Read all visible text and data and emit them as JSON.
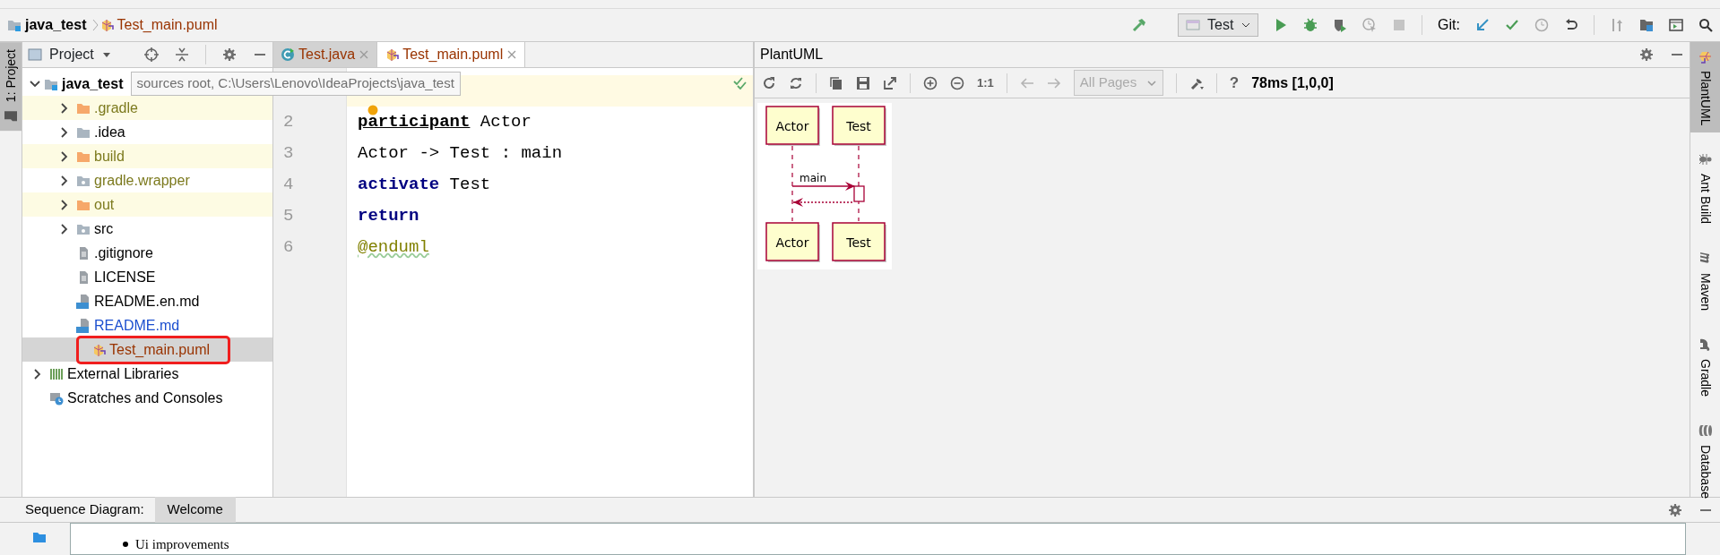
{
  "breadcrumbs": [
    {
      "label": "java_test",
      "kind": "project"
    },
    {
      "label": "Test_main.puml",
      "kind": "puml"
    }
  ],
  "run_config": {
    "label": "Test"
  },
  "git_label": "Git:",
  "left_tool_tabs": [
    {
      "label": "1: Project",
      "selected": true
    }
  ],
  "project_panel": {
    "title": "Project",
    "tree": [
      {
        "label": "java_test",
        "kind": "module",
        "expanded": true,
        "color": "#000000",
        "tooltip": "sources root,  C:\\Users\\Lenovo\\IdeaProjects\\java_test",
        "children": [
          {
            "label": ".gradle",
            "kind": "folder-excluded",
            "expanded": false,
            "color": "#7c7a1e"
          },
          {
            "label": ".idea",
            "kind": "folder",
            "expanded": false,
            "color": "#000000"
          },
          {
            "label": "build",
            "kind": "folder-excluded",
            "expanded": false,
            "color": "#7c7a1e"
          },
          {
            "label": "gradle.wrapper",
            "kind": "folder-package",
            "expanded": false,
            "color": "#7c7a1e"
          },
          {
            "label": "out",
            "kind": "folder-excluded",
            "expanded": false,
            "color": "#7c7a1e"
          },
          {
            "label": "src",
            "kind": "folder-package",
            "expanded": false,
            "color": "#000000"
          },
          {
            "label": ".gitignore",
            "kind": "file",
            "color": "#000000"
          },
          {
            "label": "LICENSE",
            "kind": "file",
            "color": "#000000"
          },
          {
            "label": "README.en.md",
            "kind": "markdown",
            "color": "#000000"
          },
          {
            "label": "README.md",
            "kind": "markdown",
            "color": "#1c4fcf"
          },
          {
            "label": "Test_main.puml",
            "kind": "puml",
            "color": "#993300",
            "selected": true,
            "marked": true
          }
        ]
      },
      {
        "label": "External Libraries",
        "kind": "libraries",
        "expanded": false,
        "color": "#000000"
      },
      {
        "label": "Scratches and Consoles",
        "kind": "scratches",
        "color": "#000000"
      }
    ]
  },
  "editor_tabs": [
    {
      "label": "Test.java",
      "kind": "java",
      "color": "#993300",
      "selected": false
    },
    {
      "label": "Test_main.puml",
      "kind": "puml",
      "color": "#993300",
      "selected": true
    }
  ],
  "editor": {
    "lines": [
      {
        "current": true
      },
      {
        "number": "2",
        "tokens": [
          {
            "text": "participant",
            "kind": "keyword-bold"
          },
          {
            "text": " Actor",
            "kind": "plain"
          }
        ]
      },
      {
        "number": "3",
        "tokens": [
          {
            "text": "Actor -> Test : main",
            "kind": "plain"
          }
        ]
      },
      {
        "number": "4",
        "tokens": [
          {
            "text": "activate",
            "kind": "keyword"
          },
          {
            "text": " Test",
            "kind": "plain"
          }
        ]
      },
      {
        "number": "5",
        "tokens": [
          {
            "text": "return",
            "kind": "keyword"
          }
        ]
      },
      {
        "number": "6",
        "tokens": [
          {
            "text": "@enduml",
            "kind": "directive"
          }
        ]
      }
    ]
  },
  "plantuml_panel": {
    "title": "PlantUML",
    "scale_label": "1:1",
    "page_selector": {
      "value": "All Pages",
      "disabled": true
    },
    "help_label": "?",
    "timing": "78ms [1,0,0]",
    "diagram": {
      "participants": [
        "Actor",
        "Test"
      ],
      "bottom_participants": [
        "Actor",
        "Test"
      ],
      "message": "main"
    }
  },
  "right_tool_tabs": [
    {
      "label": "PlantUML",
      "kind": "plantuml",
      "selected": true
    },
    {
      "label": "Ant Build",
      "kind": "ant",
      "selected": false
    },
    {
      "label": "Maven",
      "kind": "maven",
      "selected": false
    },
    {
      "label": "Gradle",
      "kind": "gradle",
      "selected": false
    },
    {
      "label": "Database",
      "kind": "database",
      "selected": false
    }
  ],
  "bottom_panel": {
    "title": "Sequence Diagram:",
    "tabs": [
      {
        "label": "Welcome",
        "selected": true
      }
    ],
    "bullets": [
      "Ui improvements"
    ]
  }
}
